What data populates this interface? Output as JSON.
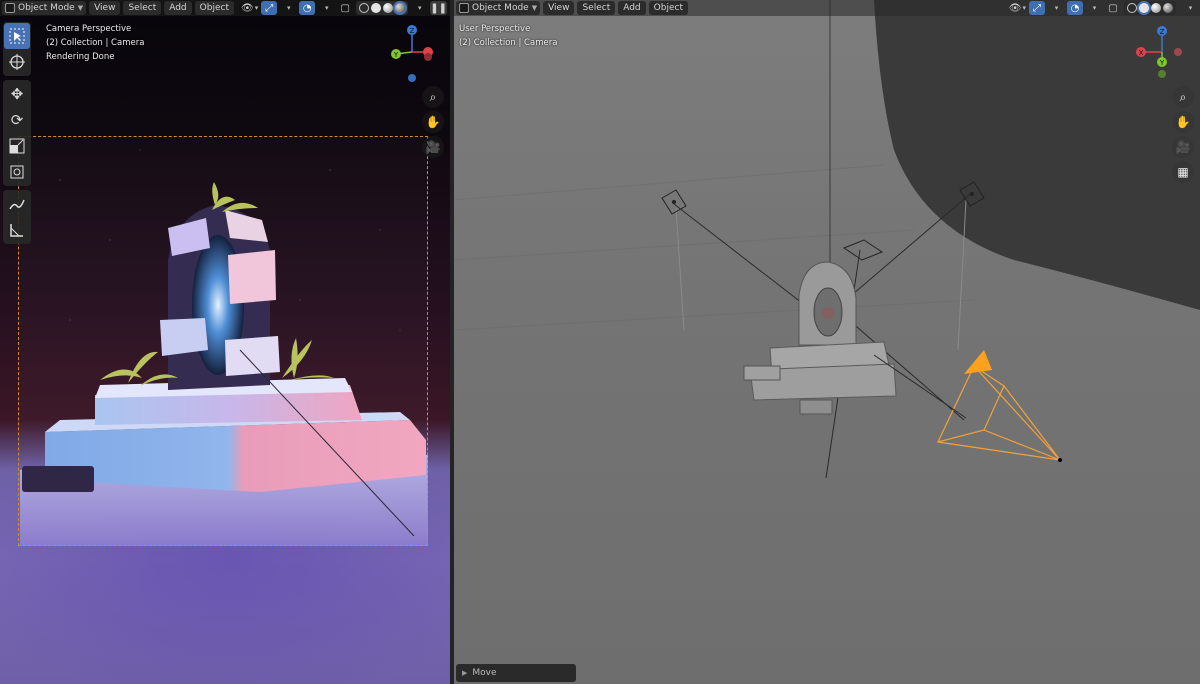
{
  "left_viewport": {
    "header": {
      "mode_label": "Object Mode",
      "menus": [
        "View",
        "Select",
        "Add",
        "Object"
      ]
    },
    "overlay": {
      "perspective": "Camera Perspective",
      "collection": "(2) Collection | Camera",
      "status": "Rendering Done"
    },
    "toolbar": [
      {
        "name": "select-box-tool",
        "icon": "cursor-box-icon",
        "glyph": "⬚",
        "active": true
      },
      {
        "name": "cursor-tool",
        "icon": "crosshair-icon",
        "glyph": "⊕",
        "active": false
      },
      {
        "name": "move-tool",
        "icon": "move-arrows-icon",
        "glyph": "✥",
        "active": false
      },
      {
        "name": "rotate-tool",
        "icon": "rotate-icon",
        "glyph": "⟳",
        "active": false
      },
      {
        "name": "scale-tool",
        "icon": "scale-icon",
        "glyph": "⤡",
        "active": false
      },
      {
        "name": "transform-tool",
        "icon": "transform-icon",
        "glyph": "⌖",
        "active": false
      },
      {
        "name": "annotate-tool",
        "icon": "pencil-icon",
        "glyph": "✎",
        "active": false
      },
      {
        "name": "measure-tool",
        "icon": "ruler-icon",
        "glyph": "📐",
        "active": false
      }
    ],
    "nav_buttons": [
      {
        "name": "zoom-icon",
        "glyph": "⌕"
      },
      {
        "name": "hand-pan-icon",
        "glyph": "✋"
      },
      {
        "name": "camera-view-icon",
        "glyph": "🎥"
      }
    ]
  },
  "right_viewport": {
    "header": {
      "mode_label": "Object Mode",
      "menus": [
        "View",
        "Select",
        "Add",
        "Object"
      ]
    },
    "overlay": {
      "perspective": "User Perspective",
      "collection": "(2) Collection | Camera"
    },
    "nav_buttons": [
      {
        "name": "zoom-icon",
        "glyph": "⌕"
      },
      {
        "name": "hand-pan-icon",
        "glyph": "✋"
      },
      {
        "name": "camera-view-icon",
        "glyph": "🎥"
      },
      {
        "name": "ortho-grid-icon",
        "glyph": "▦"
      }
    ],
    "operator_panel": {
      "label": "Move"
    }
  },
  "gizmo_axes": {
    "x": "X",
    "y": "Y",
    "z": "Z"
  },
  "colors": {
    "accent_blue": "#4772b3",
    "camera_orange": "#ffa11a",
    "axis_x": "#e0424b",
    "axis_y": "#7fc72b",
    "axis_z": "#3a7ad3"
  }
}
